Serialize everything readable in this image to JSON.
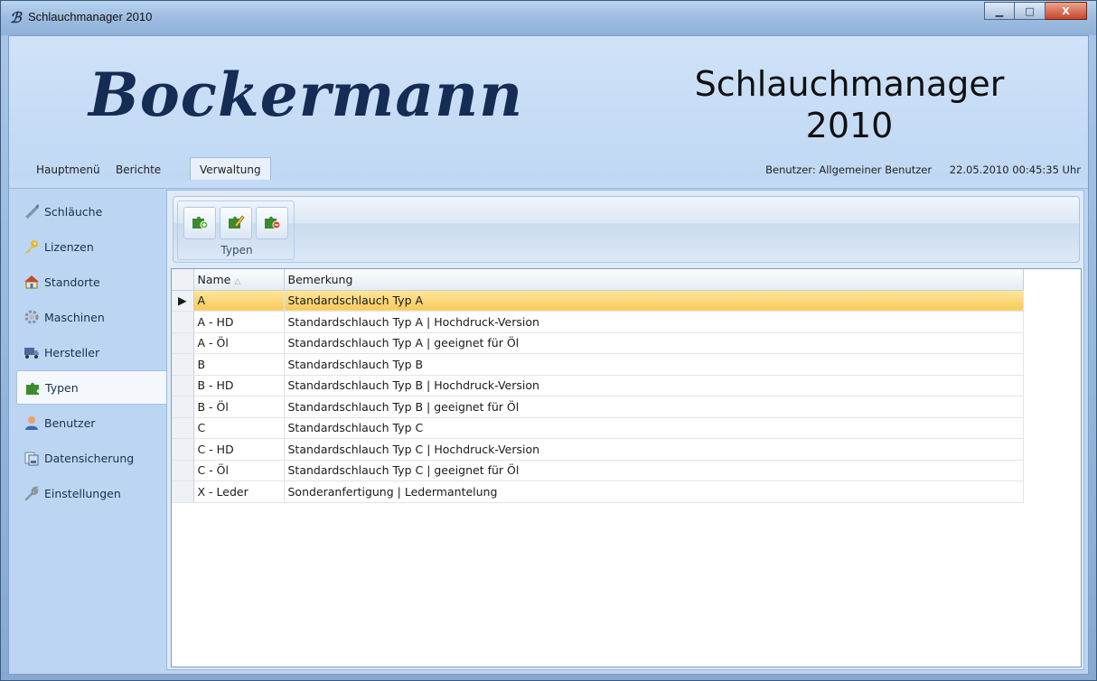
{
  "window": {
    "title": "Schlauchmanager 2010",
    "title_icon_glyph": "ℬ",
    "minimize_glyph": "▁",
    "maximize_glyph": "□",
    "close_glyph": "X"
  },
  "header": {
    "logo": "Bockermann",
    "app_name_line1": "Schlauchmanager",
    "app_name_line2": "2010"
  },
  "menu": {
    "items": [
      "Hauptmenü",
      "Berichte",
      "Verwaltung"
    ],
    "active": "Verwaltung"
  },
  "status": {
    "user": "Benutzer: Allgemeiner Benutzer",
    "datetime": "22.05.2010 00:45:35 Uhr"
  },
  "sidebar": {
    "items": [
      {
        "label": "Schläuche",
        "icon": "hose-icon"
      },
      {
        "label": "Lizenzen",
        "icon": "key-icon"
      },
      {
        "label": "Standorte",
        "icon": "house-icon"
      },
      {
        "label": "Maschinen",
        "icon": "gear-icon"
      },
      {
        "label": "Hersteller",
        "icon": "truck-icon"
      },
      {
        "label": "Typen",
        "icon": "puzzle-icon"
      },
      {
        "label": "Benutzer",
        "icon": "user-icon"
      },
      {
        "label": "Datensicherung",
        "icon": "backup-icon"
      },
      {
        "label": "Einstellungen",
        "icon": "wrench-icon"
      }
    ],
    "active": "Typen"
  },
  "ribbon": {
    "group_label": "Typen",
    "buttons": [
      {
        "icon": "puzzle-add-icon"
      },
      {
        "icon": "puzzle-edit-icon"
      },
      {
        "icon": "puzzle-delete-icon"
      }
    ]
  },
  "grid": {
    "columns": [
      "Name",
      "Bemerkung"
    ],
    "sort_indicator": "△",
    "row_pointer": "▶",
    "selected_index": 0,
    "rows": [
      {
        "name": "A",
        "bemerkung": "Standardschlauch Typ A"
      },
      {
        "name": "A - HD",
        "bemerkung": "Standardschlauch Typ A | Hochdruck-Version"
      },
      {
        "name": "A - Öl",
        "bemerkung": "Standardschlauch Typ A | geeignet für Öl"
      },
      {
        "name": "B",
        "bemerkung": "Standardschlauch Typ B"
      },
      {
        "name": "B - HD",
        "bemerkung": "Standardschlauch Typ B | Hochdruck-Version"
      },
      {
        "name": "B - Öl",
        "bemerkung": "Standardschlauch Typ B | geeignet für Öl"
      },
      {
        "name": "C",
        "bemerkung": "Standardschlauch Typ C"
      },
      {
        "name": "C - HD",
        "bemerkung": "Standardschlauch Typ C | Hochdruck-Version"
      },
      {
        "name": "C - Öl",
        "bemerkung": "Standardschlauch Typ C | geeignet für Öl"
      },
      {
        "name": "X - Leder",
        "bemerkung": "Sonderanfertigung | Ledermantelung"
      }
    ]
  },
  "colors": {
    "selection": "#f8c95c",
    "logo": "#152c55",
    "accent": "#3c8a2e"
  }
}
